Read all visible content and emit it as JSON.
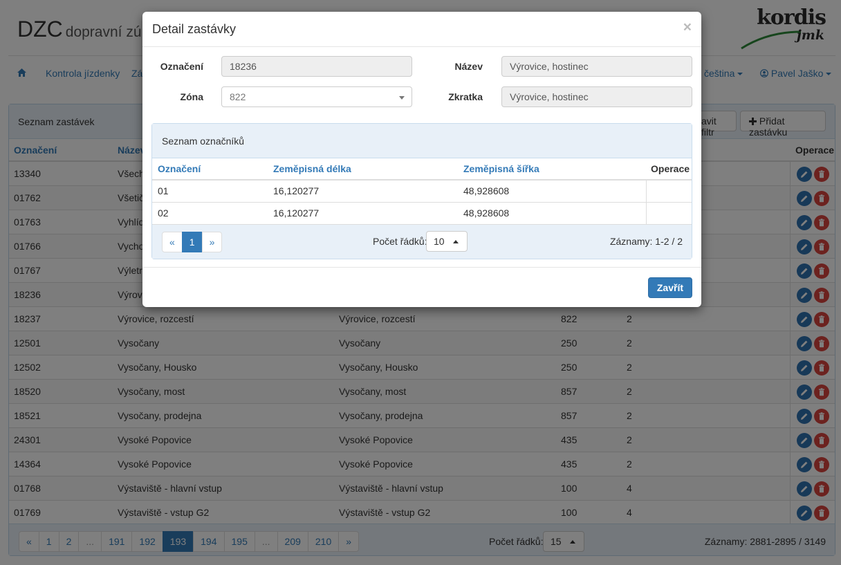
{
  "app": {
    "brand": "DZC",
    "brand_sub": "dopravní zú",
    "logo_top": "kordis",
    "logo_bottom": "jmk"
  },
  "nav": {
    "home_icon": "home-icon",
    "kontrola": "Kontrola jízdenky",
    "za": "Zá",
    "language": "čeština",
    "user": "Pavel Jaško"
  },
  "panel": {
    "title": "Seznam zastávek",
    "filter_button": "avit filtr",
    "add_button": "Přidat zastávku",
    "headers": {
      "oznaceni": "Označení",
      "nazev": "Název",
      "operace": "Operace"
    }
  },
  "rows": [
    {
      "id": "13340",
      "name": "Všech",
      "short": "",
      "zone": "",
      "count": ""
    },
    {
      "id": "01762",
      "name": "Všetič",
      "short": "",
      "zone": "",
      "count": ""
    },
    {
      "id": "01763",
      "name": "Vyhlíd",
      "short": "",
      "zone": "",
      "count": ""
    },
    {
      "id": "01766",
      "name": "Vychod",
      "short": "",
      "zone": "",
      "count": ""
    },
    {
      "id": "01767",
      "name": "Výletn",
      "short": "",
      "zone": "",
      "count": ""
    },
    {
      "id": "18236",
      "name": "Výrovi",
      "short": "",
      "zone": "",
      "count": ""
    },
    {
      "id": "18237",
      "name": "Výrovice, rozcestí",
      "short": "Výrovice, rozcestí",
      "zone": "822",
      "count": "2"
    },
    {
      "id": "12501",
      "name": "Vysočany",
      "short": "Vysočany",
      "zone": "250",
      "count": "2"
    },
    {
      "id": "12502",
      "name": "Vysočany, Housko",
      "short": "Vysočany, Housko",
      "zone": "250",
      "count": "2"
    },
    {
      "id": "18520",
      "name": "Vysočany, most",
      "short": "Vysočany, most",
      "zone": "857",
      "count": "2"
    },
    {
      "id": "18521",
      "name": "Vysočany, prodejna",
      "short": "Vysočany, prodejna",
      "zone": "857",
      "count": "2"
    },
    {
      "id": "24301",
      "name": "Vysoké Popovice",
      "short": "Vysoké Popovice",
      "zone": "435",
      "count": "2"
    },
    {
      "id": "14364",
      "name": "Vysoké Popovice",
      "short": "Vysoké Popovice",
      "zone": "435",
      "count": "2"
    },
    {
      "id": "01768",
      "name": "Výstaviště - hlavní vstup",
      "short": "Výstaviště - hlavní vstup",
      "zone": "100",
      "count": "4"
    },
    {
      "id": "01769",
      "name": "Výstaviště - vstup G2",
      "short": "Výstaviště - vstup G2",
      "zone": "100",
      "count": "4"
    }
  ],
  "pagination": {
    "pages": [
      "«",
      "1",
      "2",
      "...",
      "191",
      "192",
      "193",
      "194",
      "195",
      "...",
      "209",
      "210",
      "»"
    ],
    "active": "193",
    "rows_label": "Počet řádků:",
    "rows_value": "15",
    "records": "Záznamy: 2881-2895 / 3149"
  },
  "modal": {
    "title": "Detail zastávky",
    "close": "×",
    "labels": {
      "oznaceni": "Označení",
      "zona": "Zóna",
      "nazev": "Název",
      "zkratka": "Zkratka"
    },
    "values": {
      "oznaceni": "18236",
      "zona": "822",
      "nazev": "Výrovice, hostinec",
      "zkratka": "Výrovice, hostinec"
    },
    "sub": {
      "title": "Seznam označníků",
      "headers": {
        "oznaceni": "Označení",
        "delka": "Zeměpisná délka",
        "sirka": "Zeměpisná šířka",
        "operace": "Operace"
      },
      "rows": [
        {
          "oznaceni": "01",
          "delka": "16,120277",
          "sirka": "48,928608"
        },
        {
          "oznaceni": "02",
          "delka": "16,120277",
          "sirka": "48,928608"
        }
      ],
      "pager": [
        "«",
        "1",
        "»"
      ],
      "rows_label": "Počet řádků:",
      "rows_value": "10",
      "records": "Záznamy: 1-2 / 2"
    },
    "close_button": "Zavřít"
  },
  "colors": {
    "accent": "#337ab7",
    "danger": "#d9443f",
    "panel_bg": "#e8f0f8"
  }
}
